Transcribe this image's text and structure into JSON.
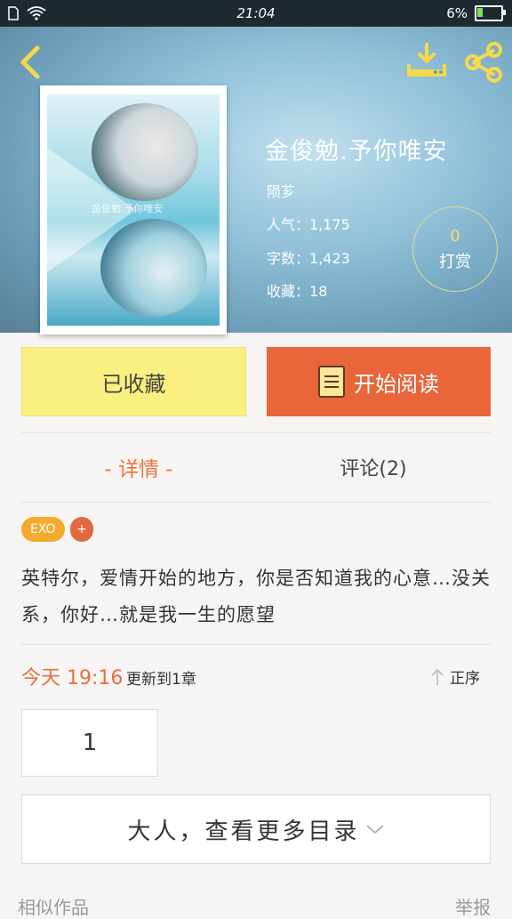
{
  "status_bar": {
    "time": "21:04",
    "battery": "6%"
  },
  "book": {
    "title": "金俊勉.予你唯安",
    "author": "陨芗",
    "popularity_label": "人气：",
    "popularity": "1,175",
    "wordcount_label": "字数：",
    "wordcount": "1,423",
    "favorites_label": "收藏：",
    "favorites": "18",
    "tip_count": "0",
    "tip_label": "打赏",
    "cover_text": "金俊勉.予你唯安"
  },
  "actions": {
    "favorited_label": "已收藏",
    "start_reading_label": "开始阅读"
  },
  "tabs": {
    "detail": "- 详情 -",
    "comments": "评论(2)"
  },
  "tags": [
    "EXO"
  ],
  "tag_add": "+",
  "description": "英特尔，爱情开始的地方，你是否知道我的心意…没关系，你好…就是我一生的愿望",
  "update": {
    "time": "今天 19:16",
    "text": "更新到1章",
    "order_label": "正序"
  },
  "chapters": [
    "1"
  ],
  "more_catalog": "大人，查看更多目录",
  "bottom": {
    "left": "相似作品",
    "right": "举报"
  },
  "colors": {
    "accent_orange": "#e8663a",
    "fav_yellow": "#fbef7f",
    "tag_orange": "#f3ab2e",
    "icon_yellow": "#f5d94a"
  },
  "icons": [
    "back-arrow-icon",
    "download-icon",
    "share-icon",
    "book-icon",
    "sort-up-arrow-icon",
    "chevron-down-icon",
    "wifi-icon",
    "sim-icon",
    "battery-icon"
  ]
}
